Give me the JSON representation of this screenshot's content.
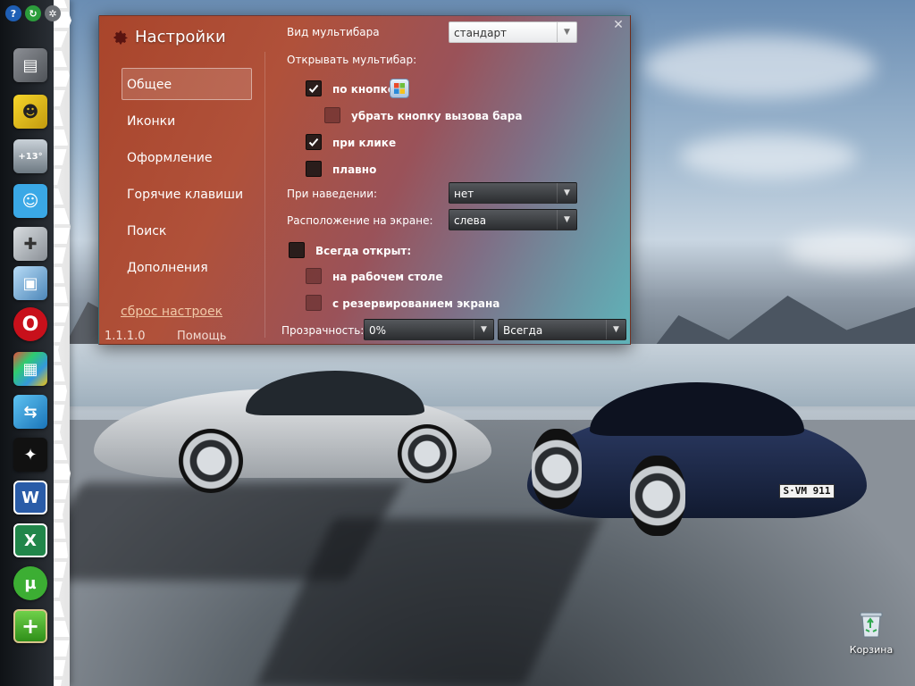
{
  "dialog": {
    "title": "Настройки",
    "nav_items": [
      "Общее",
      "Иконки",
      "Оформление",
      "Горячие клавиши",
      "Поиск",
      "Дополнения"
    ],
    "reset_link": "сброс настроек",
    "version": "1.1.1.0",
    "help": "Помощь"
  },
  "general": {
    "multibar_view_label": "Вид мультибара",
    "multibar_view_value": "стандарт",
    "open_multibar_label": "Открывать мультибар:",
    "by_button": {
      "label": "по кнопке",
      "checked": true
    },
    "remove_bar_button": {
      "label": "убрать кнопку вызова бара",
      "checked": false
    },
    "on_click": {
      "label": "при клике",
      "checked": true
    },
    "smooth": {
      "label": "плавно",
      "checked": false
    },
    "on_hover_label": "При наведении:",
    "on_hover_value": "нет",
    "screen_position_label": "Расположение на экране:",
    "screen_position_value": "слева",
    "always_open": {
      "label": "Всегда открыт:",
      "checked": false
    },
    "on_desktop": {
      "label": "на рабочем столе",
      "checked": false
    },
    "reserve_screen": {
      "label": "с резервированием экрана",
      "checked": false
    },
    "transparency_label": "Прозрачность:",
    "transparency_value": "0%",
    "transparency_mode_value": "Всегда"
  },
  "dock": {
    "weather_temp": "+13°",
    "icons": [
      "folder-icon",
      "icq-icon",
      "weather-icon",
      "robot-icon",
      "gamepad-icon",
      "computer-icon",
      "opera-icon",
      "mosaic-icon",
      "sync-icon",
      "foobar-icon",
      "word-icon",
      "excel-icon",
      "utorrent-icon",
      "add-icon"
    ]
  },
  "desktop": {
    "recycle_bin_label": "Корзина",
    "car_plate": "S·VM 911"
  },
  "colors": {
    "dialog_gradient_start": "#a9452b",
    "dialog_gradient_end": "#5fb3b8",
    "link_color": "#f0c9a8"
  }
}
